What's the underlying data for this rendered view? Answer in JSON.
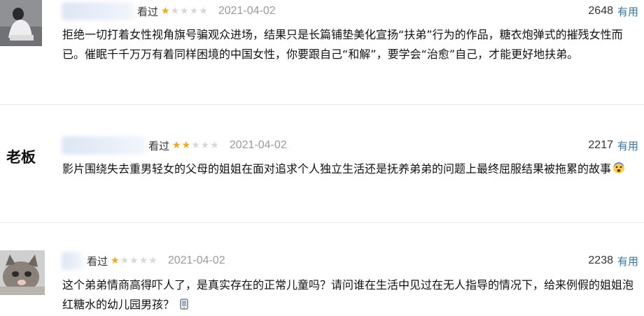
{
  "reviews": [
    {
      "watched_label": "看过",
      "rating": 1,
      "date": "2021-04-02",
      "votes": "2648",
      "useful_label": "有用",
      "text": "拒绝一切打着女性视角旗号骗观众进场，结果只是长篇铺垫美化宣扬“扶弟”行为的作品，糖衣炮弹式的摧残女性而已。催眠千千万万有着同样困境的中国女性，你要跟自己“和解”，要学会“治愈”自己，才能更好地扶弟。"
    },
    {
      "watched_label": "看过",
      "rating": 2,
      "date": "2021-04-02",
      "votes": "2217",
      "useful_label": "有用",
      "avatar_text": "老板",
      "text": "影片围绕失去重男轻女的父母的姐姐在面对追求个人独立生活还是抚养弟弟的问题上最终屈服结果被拖累的故事",
      "emoji_icon": "fearful-face-icon"
    },
    {
      "watched_label": "看过",
      "rating": 1,
      "date": "2021-04-02",
      "votes": "2238",
      "useful_label": "有用",
      "text": "这个弟弟情商高得吓人了，是真实存在的正常儿童吗？请问谁在生活中见过在无人指导的情况下，给来例假的姐姐泡红糖水的幼儿园男孩？",
      "emoji_icon": "mobile-phone-icon"
    }
  ],
  "colors": {
    "star": "#f3a712",
    "link": "#3377aa",
    "date": "#9a9a9a"
  }
}
